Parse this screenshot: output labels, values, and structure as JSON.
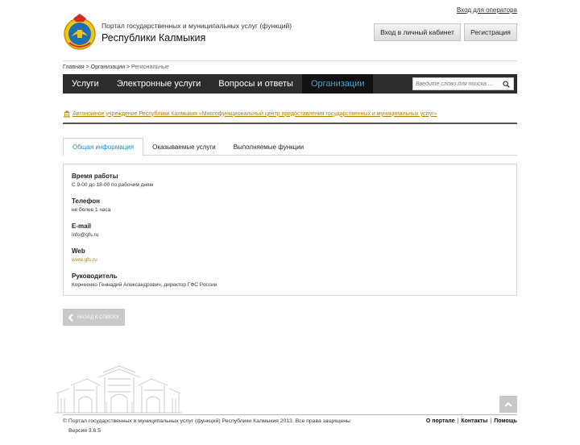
{
  "header": {
    "operator_link": "Вход для оператора",
    "portal_subtitle": "Портал государственных и муниципальных услуг (функций)",
    "portal_title": "Республики Калмыкия",
    "cabinet_button": "Вход в личный кабинет",
    "register_button": "Регистрация"
  },
  "breadcrumb": {
    "home": "Главная",
    "sep": ">",
    "orgs": "Организации",
    "current": "Региональные"
  },
  "nav": {
    "items": [
      {
        "label": "Услуги"
      },
      {
        "label": "Электронные услуги"
      },
      {
        "label": "Вопросы и ответы"
      },
      {
        "label": "Организации"
      }
    ],
    "active_index": 3,
    "search_placeholder": "Введите слово для поиска ..."
  },
  "organization": {
    "name": "Автономное учреждение Республики Калмыкия «Многофункциональный центр предоставления государственных и муниципальных услуг»"
  },
  "tabs": [
    {
      "label": "Общая информация"
    },
    {
      "label": "Оказываемые услуги"
    },
    {
      "label": "Выполняемые функции"
    }
  ],
  "details": [
    {
      "label": "Время работы",
      "value": "С 9-00 до 18-00 по рабочим дням"
    },
    {
      "label": "Телефон",
      "value": "не более 1 часа"
    },
    {
      "label": "E-mail",
      "value": "info@gfs.ru"
    },
    {
      "label": "Web",
      "value": "www.gfs.ru"
    },
    {
      "label": "Руководитель",
      "value": "Корнеенко Геннадий Александрович, директор ГФС России"
    }
  ],
  "back_button": "НАЗАД К СПИСКУ",
  "footer": {
    "copyright": "© Портал государственных и муниципальных услуг (функций) Республики Калмыкия 2013. Все права защищены",
    "version": "Версия 3.6.5",
    "links": [
      "О портале",
      "Контакты",
      "Помощь"
    ],
    "link_separator": "|"
  },
  "colors": {
    "nav_bg": "#2d2d2d",
    "nav_active_text": "#35a8e0",
    "link_gold": "#b07c00",
    "tab_active_text": "#1d8fc8"
  }
}
